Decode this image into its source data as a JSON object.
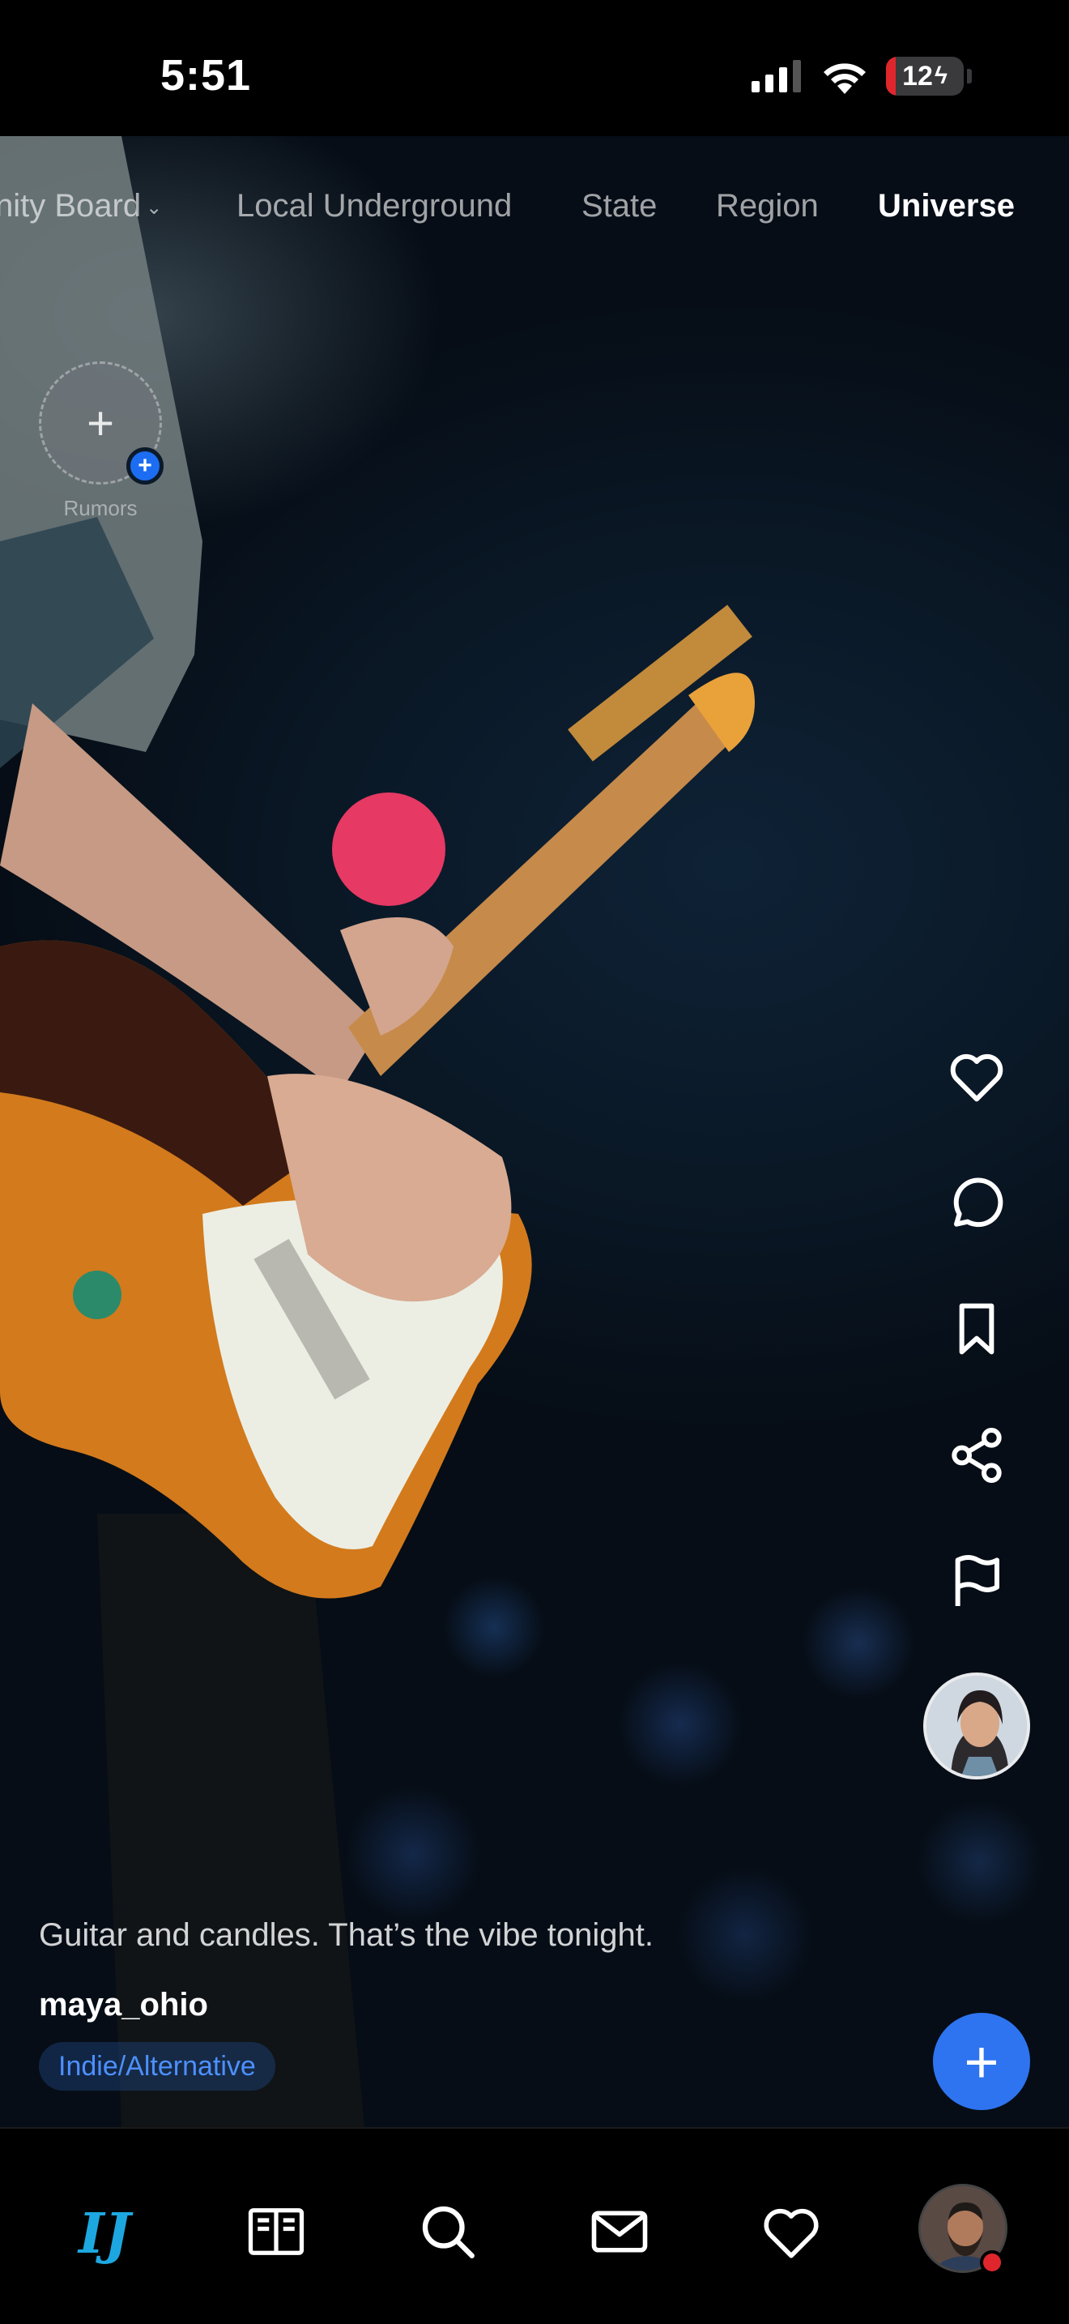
{
  "status_bar": {
    "time": "5:51",
    "battery_percent": 12,
    "battery_label": "12"
  },
  "tabs": [
    {
      "label": "nity Board",
      "active": false,
      "has_dropdown": true
    },
    {
      "label": "Local Underground",
      "active": false
    },
    {
      "label": "State",
      "active": false
    },
    {
      "label": "Region",
      "active": false
    },
    {
      "label": "Universe",
      "active": true
    }
  ],
  "story": {
    "label": "Rumors",
    "icon": "plus-icon",
    "badge_icon": "plus-badge-icon"
  },
  "post": {
    "caption": "Guitar and candles. That’s the vibe tonight.",
    "username": "maya_ohio",
    "genre": "Indie/Alternative"
  },
  "actions": [
    "heart-icon",
    "comment-icon",
    "bookmark-icon",
    "share-icon",
    "flag-icon"
  ],
  "fab_icon": "plus-icon",
  "nav": [
    "logo-icon",
    "book-icon",
    "search-icon",
    "mail-icon",
    "heart-icon",
    "profile-avatar"
  ],
  "colors": {
    "accent": "#2e74f0",
    "genre_text": "#4d90ff",
    "notification": "#e0262d",
    "logo": "#1da7e0"
  }
}
